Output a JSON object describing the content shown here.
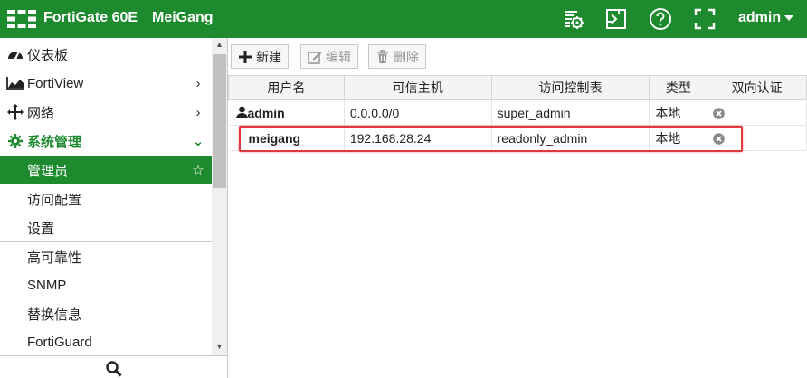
{
  "topbar": {
    "device_name": "FortiGate 60E",
    "host_name": "MeiGang",
    "user": "admin",
    "icons": [
      "logo-icon",
      "cli-console-icon",
      "fullscreen-console-icon",
      "help-icon",
      "fullscreen-icon",
      "caret-down-icon"
    ]
  },
  "sidebar": {
    "items": [
      {
        "label": "仪表板",
        "icon": "dashboard-icon"
      },
      {
        "label": "FortiView",
        "icon": "fortiview-icon"
      },
      {
        "label": "网络",
        "icon": "network-icon"
      },
      {
        "label": "系统管理",
        "icon": "gear-icon"
      },
      {
        "label": "管理员"
      },
      {
        "label": "访问配置"
      },
      {
        "label": "设置"
      },
      {
        "label": "高可靠性"
      },
      {
        "label": "SNMP"
      },
      {
        "label": "替换信息"
      },
      {
        "label": "FortiGuard"
      }
    ]
  },
  "toolbar": {
    "new_label": "新建",
    "edit_label": "编辑",
    "delete_label": "删除"
  },
  "table": {
    "columns": [
      "用户名",
      "可信主机",
      "访问控制表",
      "类型",
      "双向认证"
    ],
    "rows": [
      {
        "name": "admin",
        "trusted_host": "0.0.0.0/0",
        "profile": "super_admin",
        "type": "本地"
      },
      {
        "name": "meigang",
        "trusted_host": "192.168.28.24",
        "profile": "readonly_admin",
        "type": "本地"
      }
    ]
  },
  "colors": {
    "brand_green": "#1e8a2e",
    "highlight_red": "#e0393e"
  }
}
